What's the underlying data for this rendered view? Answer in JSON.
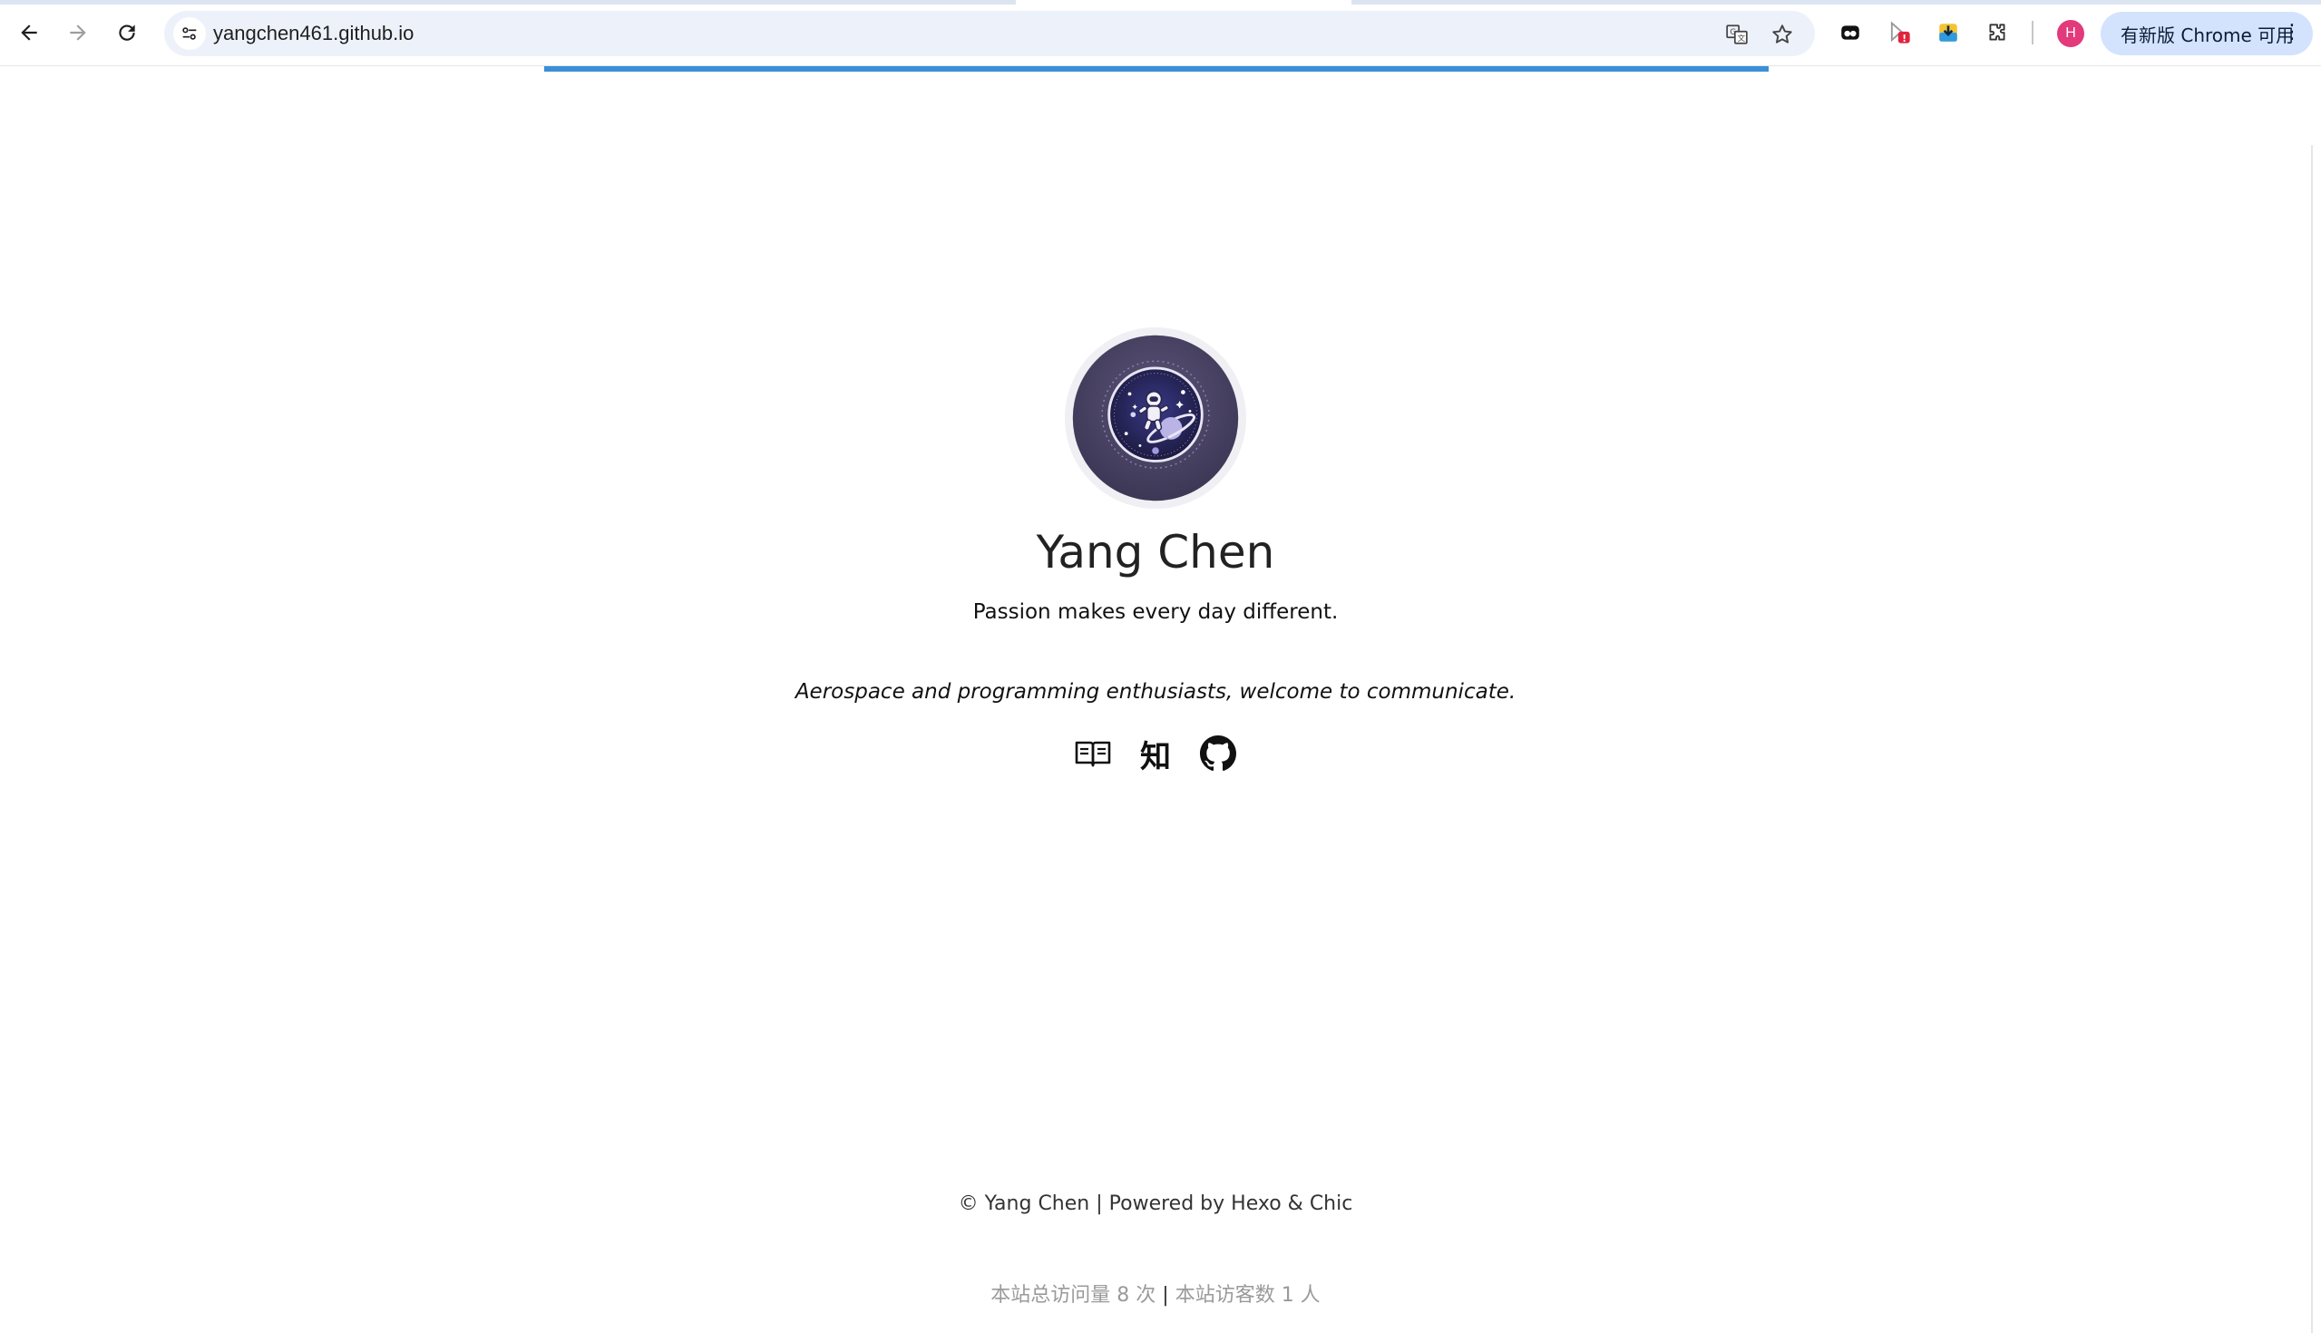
{
  "browser": {
    "url": "yangchen461.github.io",
    "update_button_label": "有新版 Chrome 可用",
    "profile_initial": "H",
    "nav_icons": [
      "back-arrow-icon",
      "forward-arrow-icon",
      "reload-icon"
    ],
    "toolbar_icons": [
      "translate-icon",
      "bookmark-star-icon",
      "extension-icon",
      "extension-badge-icon",
      "download-extension-icon",
      "puzzle-extensions-icon"
    ]
  },
  "page": {
    "author_name": "Yang Chen",
    "slogan": "Passion makes every day different.",
    "description": "Aerospace and programming enthusiasts, welcome to communicate.",
    "social_links": [
      {
        "name": "book-icon",
        "label": ""
      },
      {
        "name": "zhihu-icon",
        "label": "知"
      },
      {
        "name": "github-icon",
        "label": ""
      }
    ],
    "footer": {
      "copyright": "© Yang Chen |",
      "powered_by_prefix": "Powered by",
      "hexo": "Hexo",
      "amp": "&",
      "chic": "Chic"
    },
    "stats": {
      "total_views": "本站总访问量 8 次",
      "separator": "|",
      "visitors": "本站访客数 1 人"
    },
    "colors": {
      "progress_bar": "#3a8fd6",
      "avatar_bg": "#4a4565",
      "update_button_bg": "#d3e3fd"
    }
  }
}
